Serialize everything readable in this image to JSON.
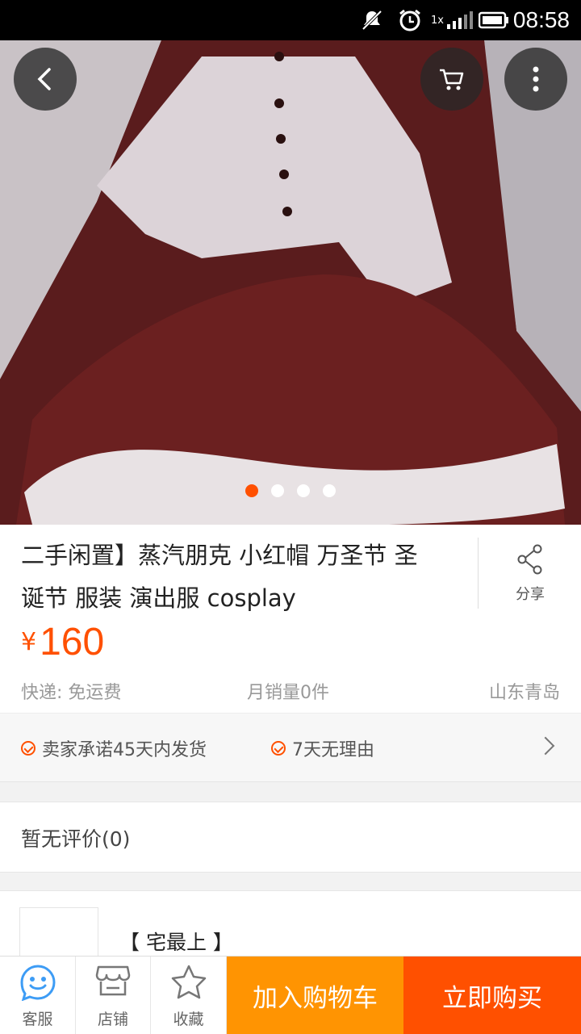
{
  "status_bar": {
    "time": "08:58",
    "network_label": "1x"
  },
  "product": {
    "title": "二手闲置】蒸汽朋克 小红帽 万圣节 圣诞节 服装 演出服 cosplay",
    "currency": "¥",
    "price": "160",
    "shipping": "快递: 免运费",
    "monthly_sales": "月销量0件",
    "location": "山东青岛",
    "gallery": {
      "image_count": 4,
      "active_index": 1
    }
  },
  "share": {
    "label": "分享"
  },
  "promises": [
    "卖家承诺45天内发货",
    "7天无理由"
  ],
  "reviews": {
    "label": "暂无评价(0)"
  },
  "shop": {
    "name": "【 宅最上 】"
  },
  "bottom_bar": {
    "service_label": "客服",
    "store_label": "店铺",
    "favorite_label": "收藏",
    "add_to_cart_label": "加入购物车",
    "buy_now_label": "立即购买"
  },
  "colors": {
    "accent": "#ff5000",
    "cart_button": "#ff9402",
    "service_icon": "#3d9cf5"
  }
}
